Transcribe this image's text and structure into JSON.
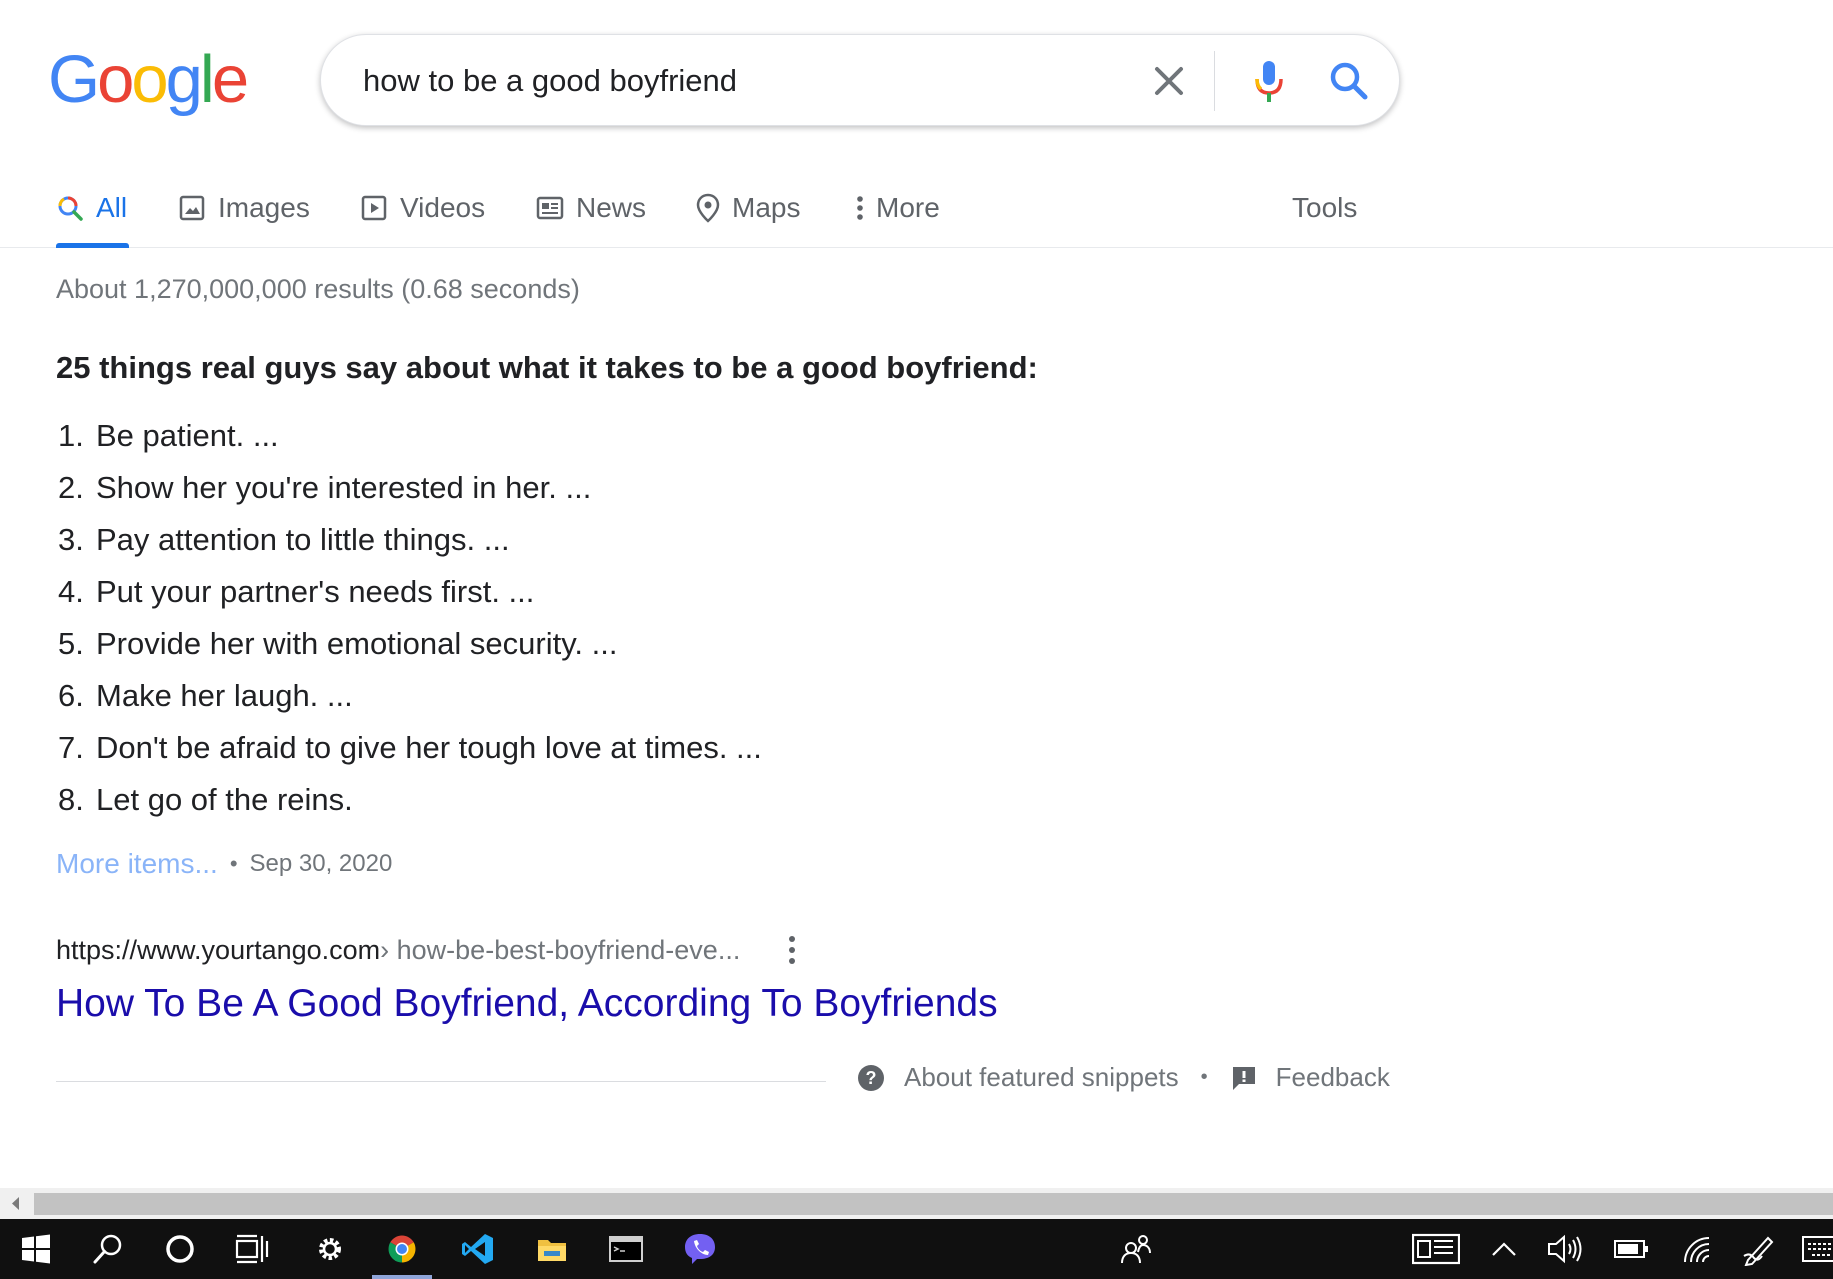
{
  "logo": {
    "letters": [
      "G",
      "o",
      "o",
      "g",
      "l",
      "e"
    ],
    "colors": [
      "#4285f4",
      "#ea4335",
      "#fbbc05",
      "#4285f4",
      "#34a853",
      "#ea4335"
    ]
  },
  "search": {
    "query": "how to be a good boyfriend"
  },
  "tabs": [
    {
      "label": "All",
      "icon": "search-icon",
      "active": true
    },
    {
      "label": "Images",
      "icon": "image-icon"
    },
    {
      "label": "Videos",
      "icon": "play-icon"
    },
    {
      "label": "News",
      "icon": "news-icon"
    },
    {
      "label": "Maps",
      "icon": "map-pin-icon"
    },
    {
      "label": "More",
      "icon": "kebab-icon"
    }
  ],
  "tools_label": "Tools",
  "result_stats": "About 1,270,000,000 results (0.68 seconds)",
  "snippet": {
    "heading": "25 things real guys say about what it takes to be a good boyfriend:",
    "items": [
      {
        "num": "1.",
        "text": "Be patient. ..."
      },
      {
        "num": "2.",
        "text": "Show her you're interested in her. ..."
      },
      {
        "num": "3.",
        "text": "Pay attention to little things. ..."
      },
      {
        "num": "4.",
        "text": "Put your partner's needs first. ..."
      },
      {
        "num": "5.",
        "text": "Provide her with emotional security. ..."
      },
      {
        "num": "6.",
        "text": "Make her laugh. ..."
      },
      {
        "num": "7.",
        "text": "Don't be afraid to give her tough love at times. ..."
      },
      {
        "num": "8.",
        "text": "Let go of the reins."
      }
    ],
    "more_link": "More items...",
    "separator": "•",
    "date": "Sep 30, 2020"
  },
  "result": {
    "cite_domain": "https://www.yourtango.com",
    "cite_path": " › how-be-best-boyfriend-eve...",
    "title": "How To Be A Good Boyfriend, According To Boyfriends"
  },
  "footer": {
    "about_label": "About featured snippets",
    "separator": "•",
    "feedback_label": "Feedback"
  },
  "taskbar": {
    "items": [
      "windows-start-icon",
      "search-icon",
      "cortana-icon",
      "task-view-icon",
      "settings-gear-icon",
      "chrome-icon",
      "vscode-icon",
      "file-explorer-icon",
      "terminal-icon",
      "viber-icon"
    ],
    "tray": [
      "people-icon",
      "news-widget-icon",
      "chevron-up-icon",
      "volume-icon",
      "battery-icon",
      "wifi-icon",
      "pen-icon",
      "keyboard-icon"
    ],
    "active_app": "chrome-icon"
  }
}
